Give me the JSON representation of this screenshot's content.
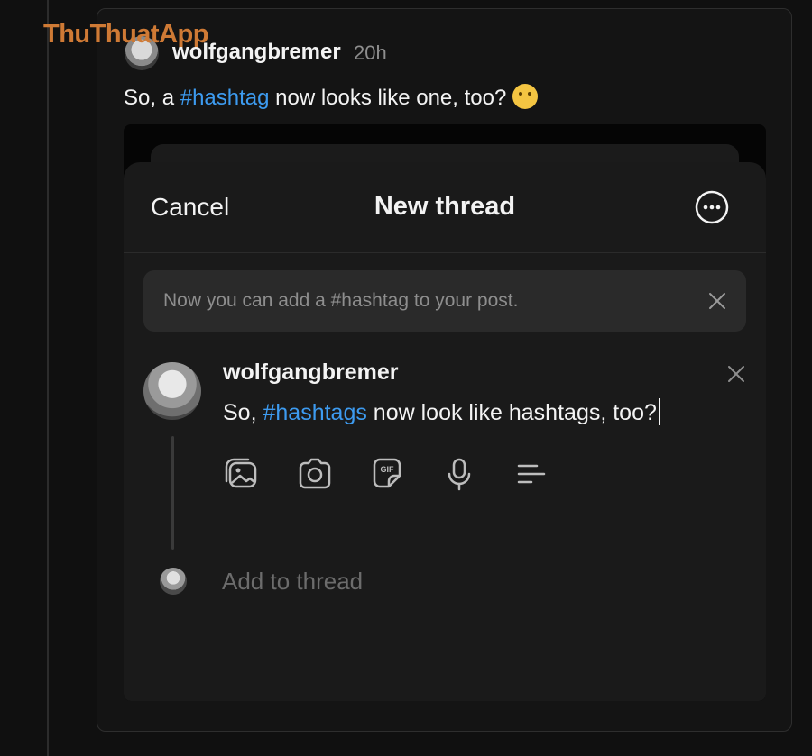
{
  "watermark": {
    "brand": "ThuThuatApp",
    "tagline": ""
  },
  "post": {
    "username": "wolfgangbremer",
    "time": "20h",
    "text_before": "So, a ",
    "hashtag": "#hashtag",
    "text_after": " now looks like one, too? ",
    "emoji": "thinking-face"
  },
  "composer": {
    "cancel_label": "Cancel",
    "title": "New thread",
    "more_icon": "ellipsis-circle-icon",
    "banner_text": "Now you can add a #hashtag to your post.",
    "username": "wolfgangbremer",
    "text_before": "So, ",
    "hashtag": "#hashtags",
    "text_after": " now look like hashtags, too?",
    "tools": [
      "gallery-icon",
      "camera-icon",
      "gif-icon",
      "microphone-icon",
      "poll-icon"
    ],
    "add_to_thread": "Add to thread"
  },
  "colors": {
    "background": "#101010",
    "hashtag": "#3d9bf0",
    "watermark": "#cf7a35",
    "sheet": "#1a1a1a"
  }
}
